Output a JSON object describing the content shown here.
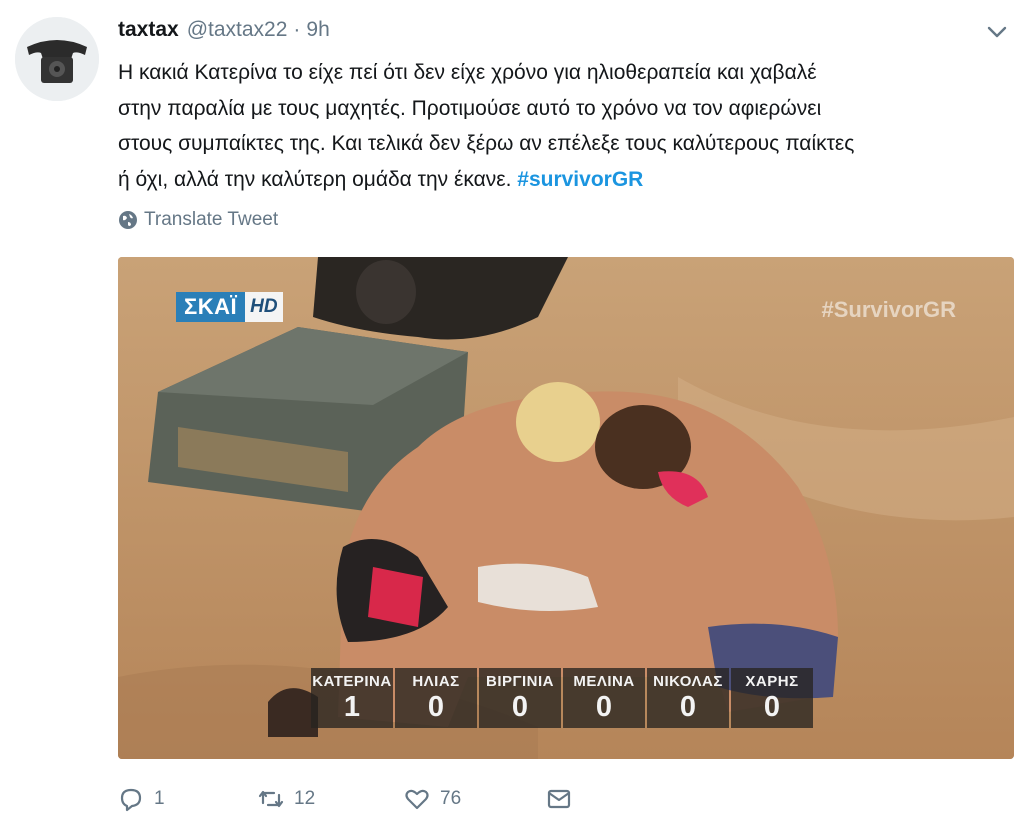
{
  "tweet": {
    "display_name": "taxtax",
    "handle": "@taxtax22",
    "separator": "·",
    "time": "9h",
    "text_lines": [
      "Η κακιά Κατερίνα το είχε πεί ότι δεν είχε χρόνο για ηλιοθεραπεία και χαβαλέ",
      "στην παραλία με τους μαχητές. Προτιμούσε αυτό το χρόνο να τον αφιερώνει",
      "στους συμπαίκτες της. Και τελικά δεν ξέρω αν επέλεξε τους καλύτερους παίκτες",
      "ή όχι, αλλά την καλύτερη ομάδα την έκανε."
    ],
    "hashtag": "#survivorGR",
    "translate_label": "Translate Tweet"
  },
  "media": {
    "channel_logo": "ΣΚΑΪ",
    "channel_hd": "HD",
    "watermark": "#SurvivorGR",
    "scoreboard": [
      {
        "name": "ΚΑΤΕΡΙΝΑ",
        "score": "1"
      },
      {
        "name": "ΗΛΙΑΣ",
        "score": "0"
      },
      {
        "name": "ΒΙΡΓΙΝΙΑ",
        "score": "0"
      },
      {
        "name": "ΜΕΛΙΝΑ",
        "score": "0"
      },
      {
        "name": "ΝΙΚΟΛΑΣ",
        "score": "0"
      },
      {
        "name": "ΧΑΡΗΣ",
        "score": "0"
      }
    ]
  },
  "actions": {
    "reply_count": "1",
    "retweet_count": "12",
    "like_count": "76"
  },
  "colors": {
    "accent": "#1b95e0",
    "secondary_text": "#657786",
    "primary_text": "#14171a"
  },
  "icons": [
    "telephone-avatar-icon",
    "chevron-down-icon",
    "globe-icon",
    "reply-icon",
    "retweet-icon",
    "heart-icon",
    "message-icon"
  ]
}
